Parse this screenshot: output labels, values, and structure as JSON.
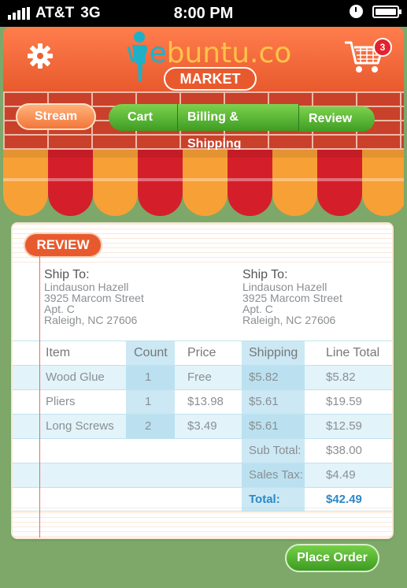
{
  "status_bar": {
    "carrier": "AT&T",
    "network": "3G",
    "time": "8:00 PM"
  },
  "header": {
    "logo_prefix": "we",
    "logo_word": "buntu.co",
    "market_label": "MARKET",
    "cart_count": "3"
  },
  "nav": {
    "stream": "Stream",
    "steps": [
      "Cart",
      "Billing & Shipping",
      "Review"
    ]
  },
  "review_label": "REVIEW",
  "ship_to": [
    {
      "title": "Ship To:",
      "name": "Lindauson Hazell",
      "street": "3925 Marcom Street",
      "apt": "Apt. C",
      "city": "Raleigh, NC 27606"
    },
    {
      "title": "Ship To:",
      "name": "Lindauson Hazell",
      "street": "3925 Marcom Street",
      "apt": "Apt. C",
      "city": "Raleigh, NC 27606"
    }
  ],
  "table": {
    "headers": [
      "Item",
      "Count",
      "Price",
      "Shipping",
      "Line Total"
    ],
    "rows": [
      [
        "Wood Glue",
        "1",
        "Free",
        "$5.82",
        "$5.82"
      ],
      [
        "Pliers",
        "1",
        "$13.98",
        "$5.61",
        "$19.59"
      ],
      [
        "Long Screws",
        "2",
        "$3.49",
        "$5.61",
        "$12.59"
      ]
    ],
    "summary": [
      {
        "label": "Sub Total:",
        "value": "$38.00"
      },
      {
        "label": "Sales Tax:",
        "value": "$4.49"
      },
      {
        "label": "Total:",
        "value": "$42.49"
      }
    ]
  },
  "place_order_label": "Place Order",
  "colors": {
    "orange": "#e85a2d",
    "green": "#3e9d23",
    "blue_total": "#2b88c8",
    "awning_red": "#d41f2b",
    "awning_orange": "#f7a036"
  },
  "icons": [
    "gear-icon",
    "cart-icon",
    "clock-icon",
    "battery-icon",
    "signal-icon"
  ]
}
